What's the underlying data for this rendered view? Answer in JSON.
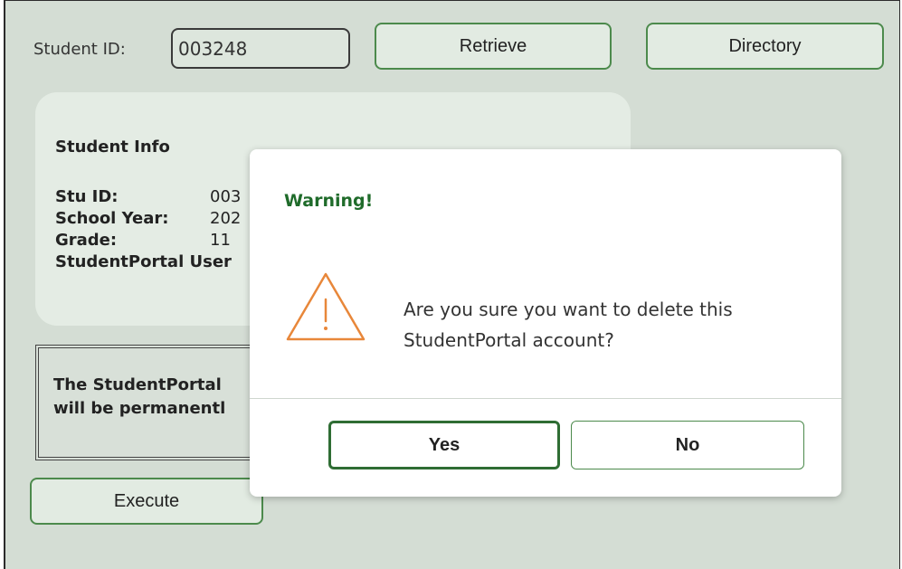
{
  "header": {
    "student_id_label": "Student ID:",
    "student_id_value": "003248",
    "retrieve_label": "Retrieve",
    "directory_label": "Directory"
  },
  "student_info": {
    "title": "Student Info",
    "stu_id_label": "Stu ID:",
    "stu_id_value": "003",
    "school_year_label": "School Year:",
    "school_year_value": "202",
    "grade_label": "Grade:",
    "grade_value": "11",
    "portal_user_label": "StudentPortal User"
  },
  "notice": {
    "line1": "The StudentPortal",
    "line2": "will be permanentl"
  },
  "execute_label": "Execute",
  "dialog": {
    "title": "Warning!",
    "icon": "warning-triangle-icon",
    "message_line1": "Are you sure you want to delete this",
    "message_line2": "StudentPortal account?",
    "yes_label": "Yes",
    "no_label": "No"
  },
  "colors": {
    "accent_green": "#1f6b2a",
    "warning_orange": "#e8873a",
    "background": "#d4ddd4"
  }
}
